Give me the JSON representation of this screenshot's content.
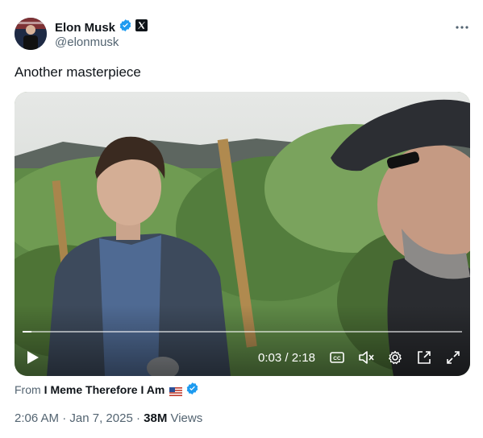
{
  "author": {
    "display_name": "Elon Musk",
    "handle": "@elonmusk",
    "verified_badge_color": "#1d9bf0",
    "affiliation_icon": "x-logo-icon"
  },
  "tweet": {
    "text": "Another masterpiece"
  },
  "video": {
    "current_time": "0:03",
    "separator": " / ",
    "duration": "2:18",
    "progress_fraction": 0.02,
    "controls": [
      "play-icon",
      "captions-icon",
      "mute-icon",
      "settings-icon",
      "picture-in-picture-icon",
      "fullscreen-icon"
    ]
  },
  "source": {
    "label": "From",
    "name": "I Meme Therefore I Am",
    "flag_icon": "us-flag-icon"
  },
  "meta": {
    "time": "2:06 AM",
    "dot": " · ",
    "date": "Jan 7, 2025",
    "views_count": "38M",
    "views_label": " Views"
  },
  "more_menu_icon": "more-icon"
}
